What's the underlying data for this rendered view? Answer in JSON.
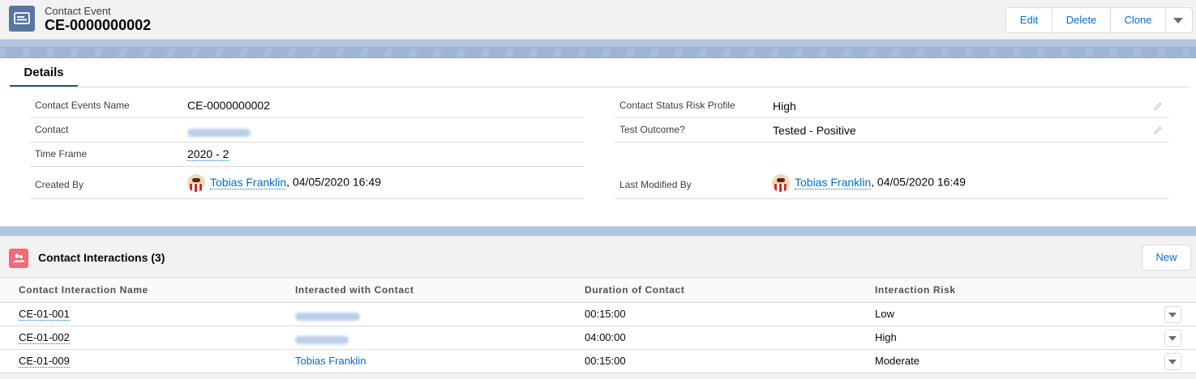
{
  "header": {
    "object_label": "Contact Event",
    "record_name": "CE-0000000002",
    "icon": "contact-event-record-icon",
    "actions": {
      "edit": "Edit",
      "delete": "Delete",
      "clone": "Clone"
    },
    "more_actions_icon": "chevron-down-icon"
  },
  "tabs": {
    "details": "Details"
  },
  "details": {
    "contact_events_name": {
      "label": "Contact Events Name",
      "value": "CE-0000000002"
    },
    "contact": {
      "label": "Contact",
      "value": ""
    },
    "time_frame": {
      "label": "Time Frame",
      "value": "2020 - 2"
    },
    "created_by": {
      "label": "Created By",
      "user": "Tobias Franklin",
      "date": ", 04/05/2020 16:49"
    },
    "contact_status_risk_profile": {
      "label": "Contact Status Risk Profile",
      "value": "High"
    },
    "test_outcome": {
      "label": "Test Outcome?",
      "value": "Tested - Positive"
    },
    "last_modified_by": {
      "label": "Last Modified By",
      "user": "Tobias Franklin",
      "date": ", 04/05/2020 16:49"
    }
  },
  "related": {
    "title": "Contact Interactions (3)",
    "icon": "contacts-related-icon",
    "new_button": "New",
    "columns": [
      "Contact Interaction Name",
      "Interacted with Contact",
      "Duration of Contact",
      "Interaction Risk"
    ],
    "rows": [
      {
        "name": "CE-01-001",
        "contact": "",
        "duration": "00:15:00",
        "risk": "Low"
      },
      {
        "name": "CE-01-002",
        "contact": "",
        "duration": "04:00:00",
        "risk": "High"
      },
      {
        "name": "CE-01-009",
        "contact": "Tobias Franklin",
        "duration": "00:15:00",
        "risk": "Moderate"
      }
    ]
  },
  "colors": {
    "brand_link": "#006dcc",
    "record_icon_bg": "#5876a3",
    "related_icon_bg": "#f26979",
    "tab_active_border": "#1b5297",
    "page_background": "#b0c4df"
  }
}
